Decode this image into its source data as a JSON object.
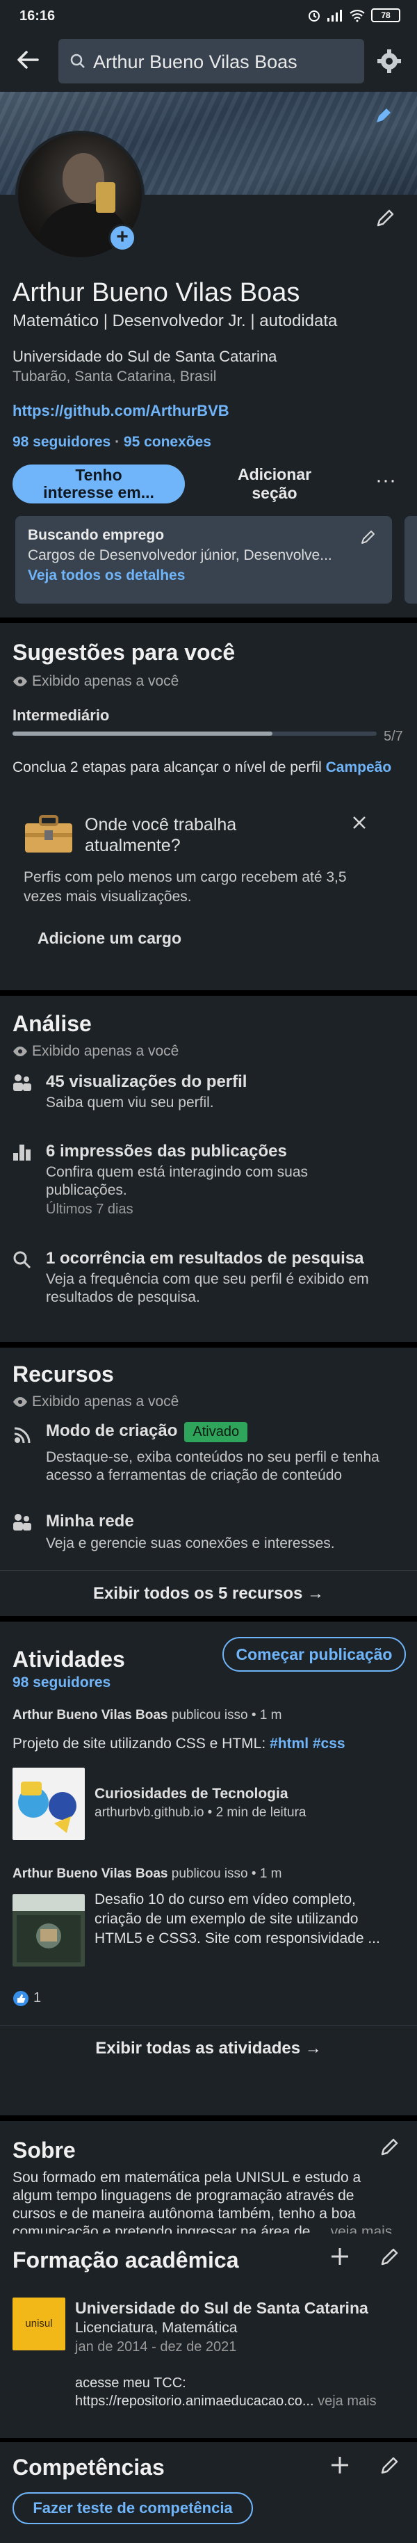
{
  "status_bar": {
    "time": "16:16",
    "battery": "78"
  },
  "search": {
    "query": "Arthur Bueno Vilas Boas"
  },
  "profile": {
    "name": "Arthur Bueno Vilas Boas",
    "headline": "Matemático | Desenvolvedor Jr. | autodidata",
    "education": "Universidade do Sul de Santa Catarina",
    "location": "Tubarão, Santa Catarina, Brasil",
    "website": "https://github.com/ArthurBVB",
    "followers": "98 seguidores",
    "separator": " · ",
    "connections": "95 conexões",
    "primary_btn_line1": "Tenho",
    "primary_btn_line2": "interesse em...",
    "secondary_btn_line1": "Adicionar",
    "secondary_btn_line2": "seção",
    "more_btn": "···",
    "open_to": {
      "title": "Buscando emprego",
      "roles": "Cargos de Desenvolvedor júnior, Desenvolve...",
      "details_link": "Veja todos os detalhes"
    }
  },
  "suggestions": {
    "title": "Sugestões para você",
    "privacy": "Exibido apenas a você",
    "level": "Intermediário",
    "progress_text": "5/7",
    "progress_value": 0.714,
    "hint_prefix": "Conclua 2 etapas para alcançar o nível de perfil ",
    "hint_level": "Campeão",
    "prompt_title_1": "Onde você trabalha",
    "prompt_title_2": "atualmente?",
    "prompt_body_1": "Perfis com pelo menos um cargo recebem até 3,5",
    "prompt_body_2": "vezes mais visualizações.",
    "prompt_cta": "Adicione um cargo"
  },
  "analytics": {
    "title": "Análise",
    "privacy": "Exibido apenas a você",
    "items": [
      {
        "title": "45 visualizações do perfil",
        "line1": "Saiba quem viu seu perfil.",
        "line2": "",
        "extra": ""
      },
      {
        "title": "6 impressões das publicações",
        "line1": "Confira quem está interagindo com suas",
        "line2": "publicações.",
        "extra": "Últimos 7 dias"
      },
      {
        "title": "1 ocorrência em resultados de pesquisa",
        "line1": "Veja a frequência com que seu perfil é exibido em",
        "line2": "resultados de pesquisa.",
        "extra": ""
      }
    ]
  },
  "resources": {
    "title": "Recursos",
    "privacy": "Exibido apenas a você",
    "creator_title": "Modo de criação",
    "creator_badge": "Ativado",
    "creator_line1": "Destaque-se, exiba conteúdos no seu perfil e tenha",
    "creator_line2": "acesso a ferramentas de criação de conteúdo",
    "network_title": "Minha rede",
    "network_line": "Veja e gerencie suas conexões e interesses.",
    "show_all": "Exibir todos os 5 recursos"
  },
  "activity": {
    "title": "Atividades",
    "followers": "98 seguidores",
    "start_post": "Começar publicação",
    "posts": [
      {
        "author": "Arthur Bueno Vilas Boas",
        "meta": " publicou isso • 1 m",
        "text_prefix": "Projeto de site utilizando CSS e HTML: ",
        "hashtags": "#html #css",
        "card_title": "Curiosidades de Tecnologia",
        "card_sub": "arthurbvb.github.io • 2 min de leitura"
      },
      {
        "author": "Arthur Bueno Vilas Boas",
        "meta": " publicou isso • 1 m",
        "line1": "Desafio 10 do curso em vídeo completo,",
        "line2": "criação de um exemplo de site utilizando",
        "line3": "HTML5 e CSS3. Site com responsividade ...",
        "reactions": "1"
      }
    ],
    "show_all": "Exibir todas as atividades"
  },
  "about": {
    "title": "Sobre",
    "line1": "Sou formado em matemática pela UNISUL e estudo a",
    "line2": "algum tempo linguagens de  programação  através de",
    "line3": "cursos e de maneira autônoma também, tenho a boa",
    "line4": "comunicação e pretendo ingressar na área de ...",
    "more": "veja mais"
  },
  "education": {
    "title": "Formação acadêmica",
    "logo_text": "unisul",
    "school": "Universidade do Sul de Santa Catarina",
    "degree": "Licenciatura, Matemática",
    "dates": "jan de 2014 - dez de 2021",
    "note1": "acesse meu TCC:",
    "note2": "https://repositorio.animaeducacao.co...",
    "more": "veja mais"
  },
  "skills": {
    "title": "Competências",
    "quiz_btn": "Fazer teste de competência"
  },
  "colors": {
    "accent": "#70b5f9",
    "card": "#1d2226",
    "badge_green": "#2ea55a"
  }
}
